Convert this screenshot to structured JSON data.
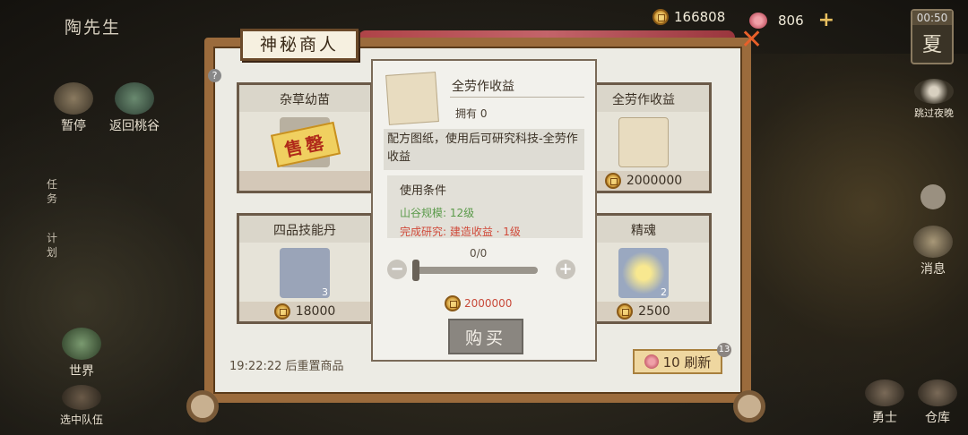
{
  "player": {
    "name": "陶先生"
  },
  "currency": {
    "coins": "166808",
    "gems": "806"
  },
  "clock": {
    "time": "00:50",
    "season": "夏"
  },
  "left_menu": {
    "pause": "暂停",
    "return": "返回桃谷",
    "tasks": "任务",
    "plan": "计划",
    "world": "世界",
    "team": "选中队伍"
  },
  "right_menu": {
    "skip_night": "跳过夜晚",
    "message": "消息",
    "hero": "勇士",
    "warehouse": "仓库"
  },
  "shop": {
    "title": "神秘商人",
    "reset_text": "19:22:22 后重置商品",
    "refresh_label": "10 刷新",
    "refresh_badge": "13",
    "items": [
      {
        "name": "杂草幼苗",
        "sold_out_label": "售罄",
        "price": "",
        "count": ""
      },
      {
        "name": "全劳作收益",
        "price": "2000000",
        "count": ""
      },
      {
        "name": "四品技能丹",
        "price": "18000",
        "count": "3"
      },
      {
        "name": "精魂",
        "price": "2500",
        "count": "2"
      }
    ]
  },
  "popup": {
    "item_name": "全劳作收益",
    "owned": "拥有 0",
    "description": "配方图纸，使用后可研究科技-全劳作收益",
    "conditions_title": "使用条件",
    "condition_1": "山谷规模: 12级",
    "condition_2": "完成研究: 建造收益 · 1级",
    "quantity": "0/0",
    "price": "2000000",
    "buy_label": "购买"
  },
  "colors": {
    "board_frame": "#9b6b3c",
    "condition_ok": "#5a9a4a",
    "condition_fail": "#d04a3a"
  }
}
